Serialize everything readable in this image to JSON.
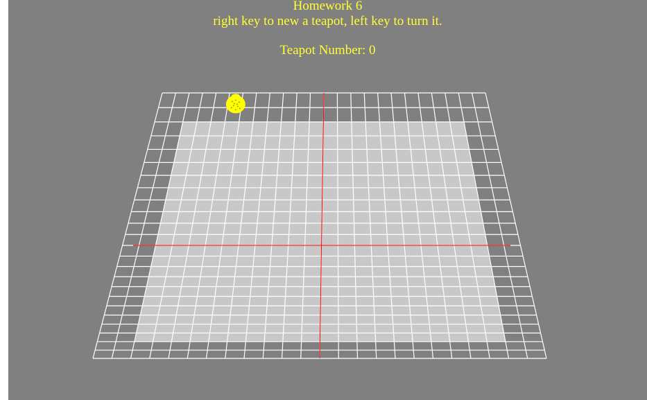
{
  "hud": {
    "title": "Homework 6",
    "instructions": "right key to new a teapot, left key to turn it.",
    "counter_label": "Teapot Number:",
    "counter_value": 0
  },
  "scene": {
    "background_color": "#808080",
    "grid_line_color": "#ffffff",
    "inner_plane_color": "#c8c8c8",
    "axis_color": "#ff0000",
    "teapot_color": "#ffff00",
    "text_color": "#ffff33",
    "grid_divisions": 24,
    "inner_plane_cells": 20,
    "teapot_grid_cell": [
      5,
      0
    ]
  }
}
